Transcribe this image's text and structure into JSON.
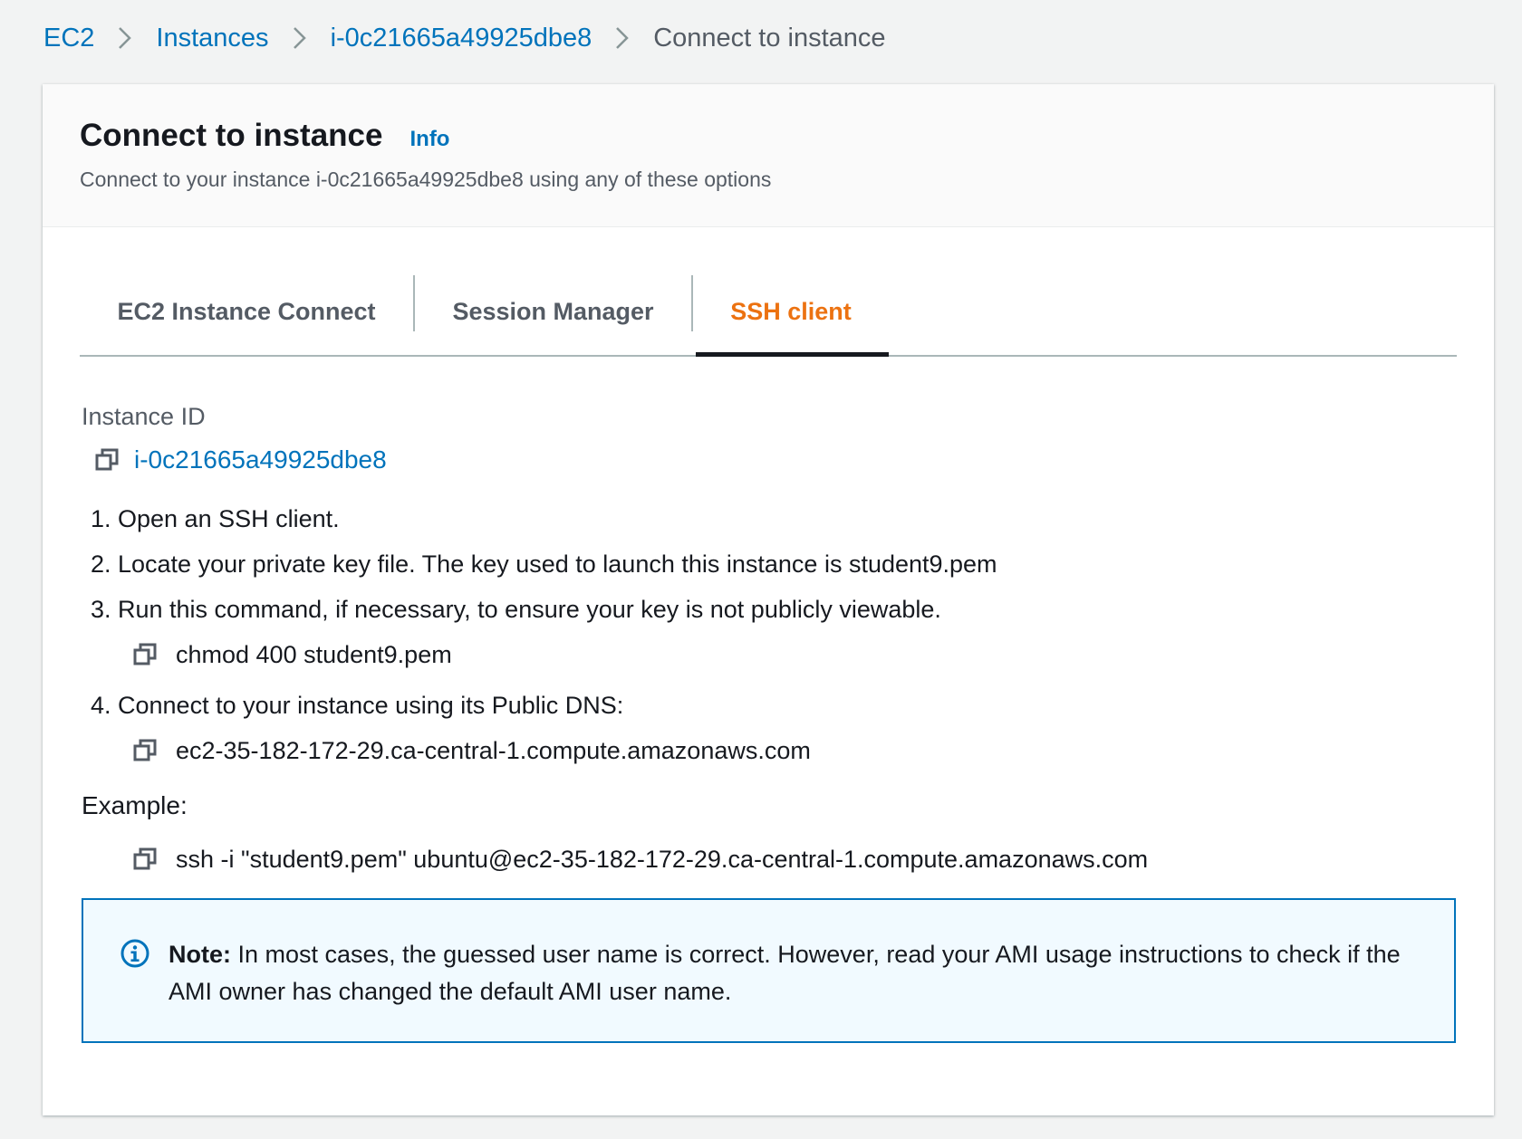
{
  "breadcrumb": {
    "items": [
      "EC2",
      "Instances",
      "i-0c21665a49925dbe8"
    ],
    "current": "Connect to instance"
  },
  "header": {
    "title": "Connect to instance",
    "info": "Info",
    "description": "Connect to your instance i-0c21665a49925dbe8 using any of these options"
  },
  "tabs": [
    {
      "label": "EC2 Instance Connect"
    },
    {
      "label": "Session Manager"
    },
    {
      "label": "SSH client",
      "active": true
    }
  ],
  "instance": {
    "label": "Instance ID",
    "id": "i-0c21665a49925dbe8"
  },
  "steps": [
    {
      "num": "1.",
      "text": "Open an SSH client."
    },
    {
      "num": "2.",
      "text": "Locate your private key file. The key used to launch this instance is student9.pem"
    },
    {
      "num": "3.",
      "text": "Run this command, if necessary, to ensure your key is not publicly viewable."
    },
    {
      "num": "4.",
      "text": "Connect to your instance using its Public DNS:"
    }
  ],
  "commands": {
    "chmod": "chmod 400 student9.pem",
    "dns": "ec2-35-182-172-29.ca-central-1.compute.amazonaws.com",
    "example_label": "Example:",
    "ssh": "ssh -i \"student9.pem\" ubuntu@ec2-35-182-172-29.ca-central-1.compute.amazonaws.com"
  },
  "note": {
    "strong": "Note:",
    "text": " In most cases, the guessed user name is correct. However, read your AMI usage instructions to check if the AMI owner has changed the default AMI user name."
  },
  "icons": {
    "copy": "copy-icon",
    "chevron": "chevron-right-icon",
    "info": "info-circle-icon"
  },
  "colors": {
    "link": "#0073bb",
    "active_tab": "#ec7211",
    "note_bg": "#f1faff",
    "note_border": "#0073bb"
  }
}
